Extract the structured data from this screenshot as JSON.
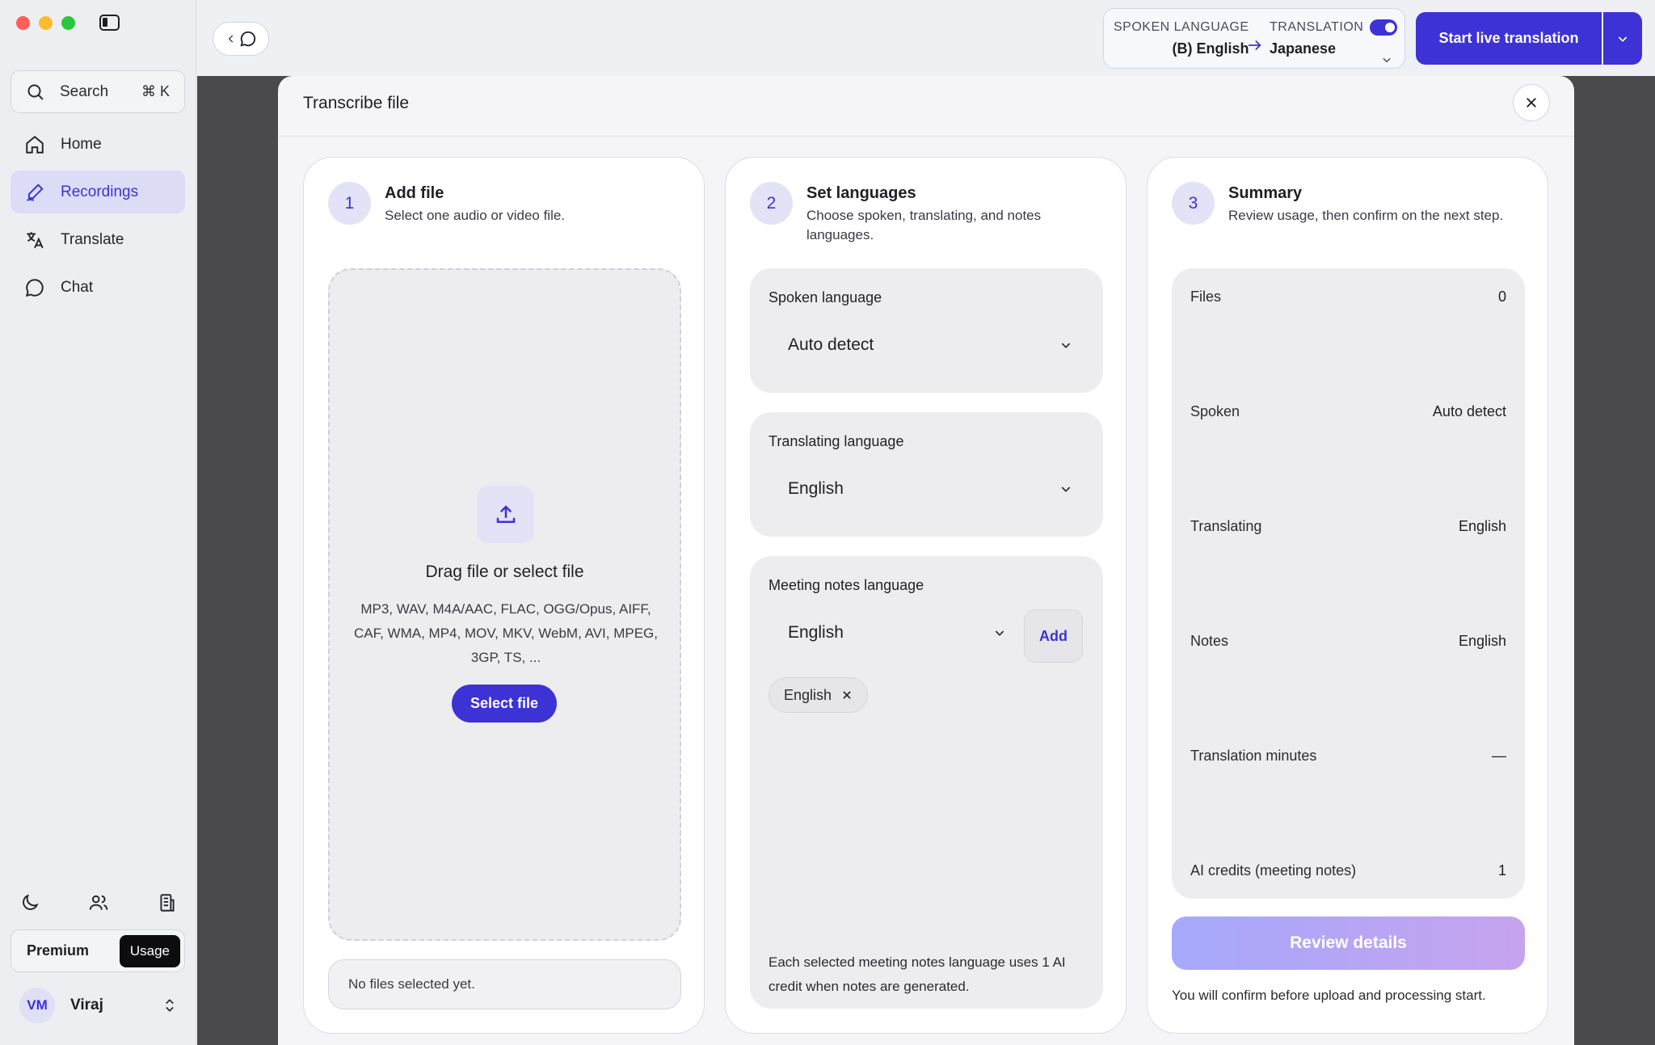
{
  "sidebar": {
    "search_label": "Search",
    "search_shortcut": "⌘ K",
    "items": [
      {
        "label": "Home",
        "icon": "home-icon"
      },
      {
        "label": "Recordings",
        "icon": "pen-icon",
        "active": true
      },
      {
        "label": "Translate",
        "icon": "translate-icon"
      },
      {
        "label": "Chat",
        "icon": "chat-icon"
      }
    ],
    "plan_label": "Premium",
    "usage_label": "Usage",
    "user_initials": "VM",
    "user_name": "Viraj"
  },
  "topbar": {
    "spoken_caption": "SPOKEN LANGUAGE",
    "spoken_value": "(B) English",
    "translation_caption": "TRANSLATION",
    "translation_value": "Japanese",
    "translation_enabled": true,
    "start_label": "Start live translation"
  },
  "modal": {
    "title": "Transcribe file",
    "step1": {
      "number": "1",
      "title": "Add file",
      "subtitle": "Select one audio or video file.",
      "drop_title": "Drag file or select file",
      "formats": "MP3, WAV, M4A/AAC, FLAC, OGG/Opus, AIFF, CAF, WMA, MP4, MOV, MKV, WebM, AVI, MPEG, 3GP, TS, ...",
      "select_label": "Select file",
      "status": "No files selected yet."
    },
    "step2": {
      "number": "2",
      "title": "Set languages",
      "subtitle": "Choose spoken, translating, and notes languages.",
      "spoken_label": "Spoken language",
      "spoken_value": "Auto detect",
      "translating_label": "Translating language",
      "translating_value": "English",
      "notes_label": "Meeting notes language",
      "notes_value": "English",
      "add_label": "Add",
      "chips": [
        "English"
      ],
      "note": "Each selected meeting notes language uses 1 AI credit when notes are generated."
    },
    "step3": {
      "number": "3",
      "title": "Summary",
      "subtitle": "Review usage, then confirm on the next step.",
      "rows": [
        {
          "label": "Files",
          "value": "0"
        },
        {
          "label": "Spoken",
          "value": "Auto detect"
        },
        {
          "label": "Translating",
          "value": "English"
        },
        {
          "label": "Notes",
          "value": "English"
        },
        {
          "label": "Translation minutes",
          "value": "—"
        },
        {
          "label": "AI credits (meeting notes)",
          "value": "1"
        }
      ],
      "review_label": "Review details",
      "confirm_note": "You will confirm before upload and processing start."
    }
  },
  "colors": {
    "accent": "#3c32d6",
    "active_bg": "#dcdcf6"
  }
}
